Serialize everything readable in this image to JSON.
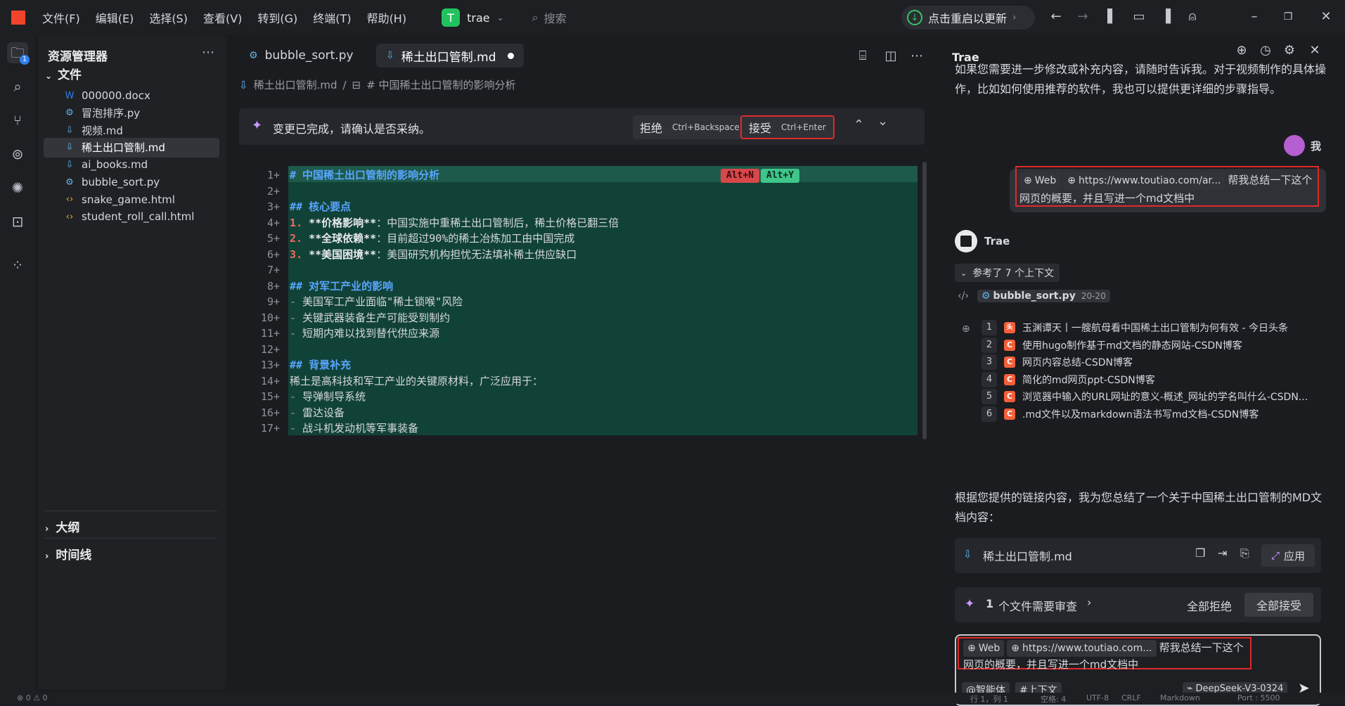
{
  "titlebar": {
    "menus": [
      "文件(F)",
      "编辑(E)",
      "选择(S)",
      "查看(V)",
      "转到(G)",
      "终端(T)",
      "帮助(H)"
    ],
    "project_badge": "T",
    "project_name": "trae",
    "search_placeholder": "搜索",
    "update_label": "点击重启以更新"
  },
  "activity": {
    "explorer_badge": "1"
  },
  "explorer": {
    "title": "资源管理器",
    "files_section": "文件",
    "files": [
      {
        "name": "000000.docx",
        "icon": "word-icon"
      },
      {
        "name": "冒泡排序.py",
        "icon": "python-icon"
      },
      {
        "name": "视频.md",
        "icon": "markdown-icon"
      },
      {
        "name": "稀土出口管制.md",
        "icon": "markdown-icon"
      },
      {
        "name": "ai_books.md",
        "icon": "markdown-icon"
      },
      {
        "name": "bubble_sort.py",
        "icon": "python-icon"
      },
      {
        "name": "snake_game.html",
        "icon": "html-icon"
      },
      {
        "name": "student_roll_call.html",
        "icon": "html-icon"
      }
    ],
    "outline_section": "大纲",
    "timeline_section": "时间线"
  },
  "editor": {
    "tabs": [
      "bubble_sort.py",
      "稀土出口管制.md"
    ],
    "breadcrumb_file": "稀土出口管制.md",
    "breadcrumb_heading": "# 中国稀土出口管制的影响分析",
    "confirm_msg": "变更已完成，请确认是否采纳。",
    "reject_label": "拒绝",
    "reject_key": "Ctrl+Backspace",
    "accept_label": "接受",
    "accept_key": "Ctrl+Enter",
    "kbd_reject": "Alt+N",
    "kbd_accept": "Alt+Y",
    "line_numbers": [
      "1+",
      "2+",
      "3+",
      "4+",
      "5+",
      "6+",
      "7+",
      "8+",
      "9+",
      "10+",
      "11+",
      "12+",
      "13+",
      "14+",
      "15+",
      "16+",
      "17+"
    ],
    "lines": [
      "# 中国稀土出口管制的影响分析",
      "",
      "## 核心要点",
      "1. **价格影响**：中国实施中重稀土出口管制后，稀土价格已翻三倍",
      "2. **全球依赖**：目前超过90%的稀土冶炼加工由中国完成",
      "3. **美国困境**：美国研究机构担忧无法填补稀土供应缺口",
      "",
      "## 对军工产业的影响",
      "- 美国军工产业面临\"稀土锁喉\"风险",
      "- 关键武器装备生产可能受到制约",
      "- 短期内难以找到替代供应来源",
      "",
      "## 背景补充",
      "稀土是高科技和军工产业的关键原材料，广泛应用于：",
      "- 导弹制导系统",
      "- 雷达设备",
      "- 战斗机发动机等军事装备"
    ]
  },
  "chat": {
    "title": "Trae",
    "intro": "如果您需要进一步修改或补充内容，请随时告诉我。对于视频制作的具体操作，比如如何使用推荐的软件，我也可以提供更详细的步骤指导。",
    "user_name": "我",
    "user_web_chip": "Web",
    "user_url_chip": "https://www.toutiao.com/ar...",
    "user_msg": "帮我总结一下这个网页的概要，并且写进一个md文档中",
    "ai_name": "Trae",
    "context_label": "参考了 7 个上下文",
    "context_file": "bubble_sort.py",
    "context_file_range": "20-20",
    "refs": [
      {
        "num": "1",
        "text": "玉渊谭天丨一艘航母看中国稀土出口管制为何有效 - 今日头条"
      },
      {
        "num": "2",
        "text": "使用hugo制作基于md文档的静态网站-CSDN博客"
      },
      {
        "num": "3",
        "text": "网页内容总结-CSDN博客"
      },
      {
        "num": "4",
        "text": "简化的md网页ppt-CSDN博客"
      },
      {
        "num": "5",
        "text": "浏览器中输入的URL网址的意义-概述_网址的学名叫什么-CSDN..."
      },
      {
        "num": "6",
        "text": ".md文件以及markdown语法书写md文档-CSDN博客"
      }
    ],
    "summary": "根据您提供的链接内容，我为您总结了一个关于中国稀土出口管制的MD文档内容：",
    "file_card": "稀土出口管制.md",
    "apply_label": "应用",
    "review_count": "1",
    "review_label": "个文件需要审查",
    "reject_all": "全部拒绝",
    "accept_all": "全部接受",
    "input_web_chip": "Web",
    "input_url_chip": "https://www.toutiao.com...",
    "input_msg": "帮我总结一下这个网页的概要，并且写进一个md文档中",
    "agent_btn": "@智能体",
    "context_btn": "#上下文",
    "model": "DeepSeek-V3-0324"
  },
  "status": {
    "left": "⊗ 0 ⚠ 0",
    "position": "行 1，列 1",
    "spaces": "空格: 4",
    "encoding": "UTF-8",
    "eol": "CRLF",
    "language": "Markdown",
    "port": "Port : 5500"
  },
  "colors": {
    "accept_red": "#e02a2a",
    "diff_green": "#114237",
    "heading_blue": "#58a6ff"
  }
}
